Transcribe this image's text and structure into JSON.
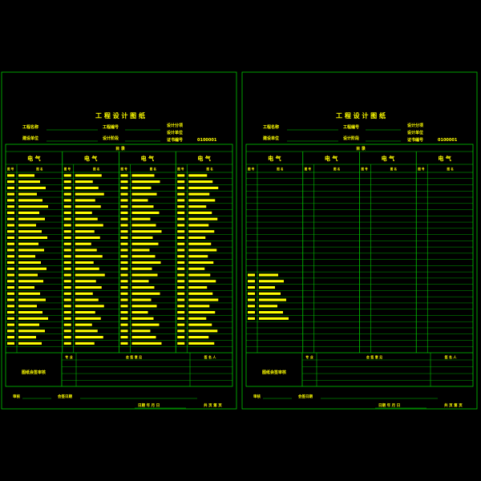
{
  "colors": {
    "background": "#000000",
    "frame": "#00c800",
    "text": "#ffff00",
    "entry": "#ffff00",
    "grid": "#00c800"
  },
  "sheets": [
    {
      "title": "工 程 设 计 图 纸",
      "project_name_label": "工程名称",
      "project_no_label": "工程编号",
      "unit_label": "建设单位",
      "stage_label": "设计阶段",
      "sub_label": "设计分项",
      "dept_label": "设计单位",
      "cert_label": "证书编号",
      "cert_value": "0100001",
      "toc_label": "目 录",
      "col_headers": [
        "电 气",
        "电 气",
        "电 气",
        "电 气"
      ],
      "sub_headers": [
        "图 号",
        "图 名"
      ],
      "bottom_left_label": "图纸会签审核",
      "bottom_col1": "专 业",
      "bottom_col2": "会 签 意 见",
      "bottom_col3": "签 名 人",
      "footer_left": "审核",
      "footer_mid": "会签日期",
      "footer_date": "日期  年  月  日",
      "footer_page": "共  页  第  页"
    },
    {
      "title": "工 程 设 计 图 纸",
      "project_name_label": "工程名称",
      "project_no_label": "工程编号",
      "unit_label": "建设单位",
      "stage_label": "设计阶段",
      "sub_label": "设计分项",
      "dept_label": "设计单位",
      "cert_label": "证书编号",
      "cert_value": "0100001",
      "toc_label": "目 录",
      "col_headers": [
        "电 气",
        "电 气",
        "电 气",
        "电 气"
      ],
      "sub_headers": [
        "图 号",
        "图 名"
      ],
      "bottom_left_label": "图纸会签审核",
      "bottom_col1": "专 业",
      "bottom_col2": "会 签 意 见",
      "bottom_col3": "签 名 人",
      "footer_left": "审核",
      "footer_mid": "会签日期",
      "footer_date": "日期  年  月  日",
      "footer_page": "共  页  第  页"
    }
  ],
  "fill_levels": {
    "sheet1_columns_filled_rows": [
      28,
      28,
      28,
      28
    ],
    "sheet2_col1_filled_rows_from": 16,
    "sheet2_col1_filled_rows_to": 23
  }
}
